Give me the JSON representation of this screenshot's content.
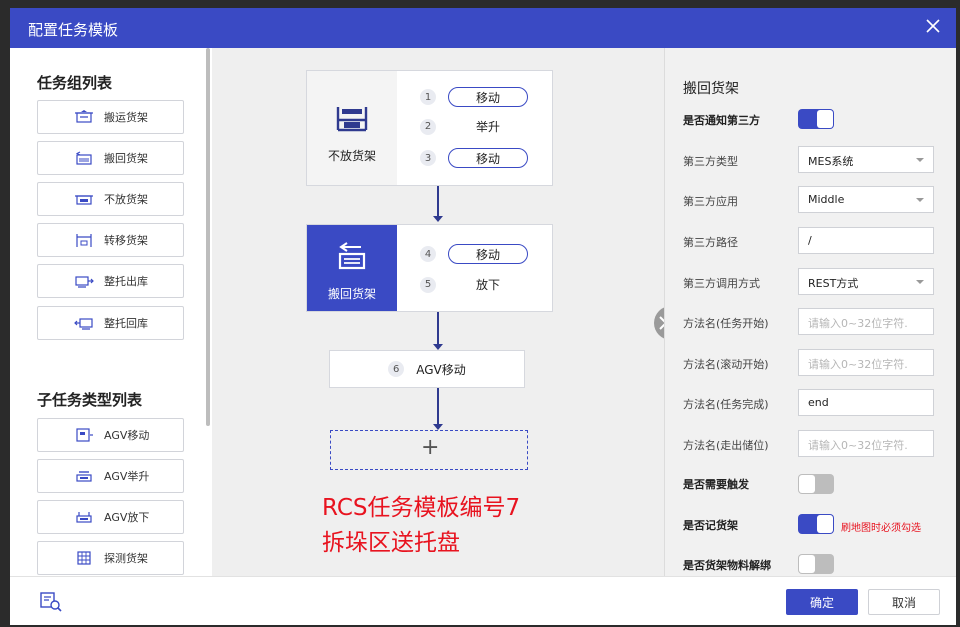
{
  "dialog": {
    "title": "配置任务模板"
  },
  "left": {
    "group_title": "任务组列表",
    "groups": [
      {
        "label": "搬运货架",
        "icon": "shelf-move-icon"
      },
      {
        "label": "搬回货架",
        "icon": "shelf-return-icon"
      },
      {
        "label": "不放货架",
        "icon": "shelf-keep-icon"
      },
      {
        "label": "转移货架",
        "icon": "shelf-transfer-icon"
      },
      {
        "label": "整托出库",
        "icon": "pallet-out-icon"
      },
      {
        "label": "整托回库",
        "icon": "pallet-in-icon"
      }
    ],
    "subtask_title": "子任务类型列表",
    "subtasks": [
      {
        "label": "AGV移动",
        "icon": "agv-move-icon"
      },
      {
        "label": "AGV举升",
        "icon": "agv-lift-icon"
      },
      {
        "label": "AGV放下",
        "icon": "agv-drop-icon"
      },
      {
        "label": "探测货架",
        "icon": "shelf-detect-icon"
      }
    ]
  },
  "flow": {
    "node1": {
      "label": "不放货架",
      "steps": [
        {
          "num": "1",
          "label": "移动",
          "style": "pill"
        },
        {
          "num": "2",
          "label": "举升",
          "style": "plain"
        },
        {
          "num": "3",
          "label": "移动",
          "style": "pill"
        }
      ]
    },
    "node2": {
      "label": "搬回货架",
      "steps": [
        {
          "num": "4",
          "label": "移动",
          "style": "pill"
        },
        {
          "num": "5",
          "label": "放下",
          "style": "plain"
        }
      ]
    },
    "node3": {
      "num": "6",
      "label": "AGV移动"
    },
    "add_symbol": "+",
    "annotation": [
      "RCS任务模板编号7",
      "拆垛区送托盘"
    ]
  },
  "right": {
    "title": "搬回货架",
    "notify_label": "是否通知第三方",
    "notify_on": true,
    "fields": [
      {
        "label": "第三方类型",
        "value": "MES系统",
        "type": "select"
      },
      {
        "label": "第三方应用",
        "value": "Middle",
        "type": "select"
      },
      {
        "label": "第三方路径",
        "value": "/",
        "type": "text"
      },
      {
        "label": "第三方调用方式",
        "value": "REST方式",
        "type": "select"
      },
      {
        "label": "方法名(任务开始)",
        "value": "请输入0~32位字符.",
        "type": "placeholder"
      },
      {
        "label": "方法名(滚动开始)",
        "value": "请输入0~32位字符.",
        "type": "placeholder"
      },
      {
        "label": "方法名(任务完成)",
        "value": "end",
        "type": "text"
      },
      {
        "label": "方法名(走出储位)",
        "value": "请输入0~32位字符.",
        "type": "placeholder"
      }
    ],
    "toggles": [
      {
        "label": "是否需要触发",
        "on": false,
        "note": ""
      },
      {
        "label": "是否记货架",
        "on": true,
        "note": "刷地图时必须勾选"
      },
      {
        "label": "是否货架物料解绑",
        "on": false,
        "note": ""
      }
    ]
  },
  "footer": {
    "ok": "确定",
    "cancel": "取消"
  },
  "colors": {
    "primary": "#3a4ac4",
    "annotation": "#e8131f"
  }
}
